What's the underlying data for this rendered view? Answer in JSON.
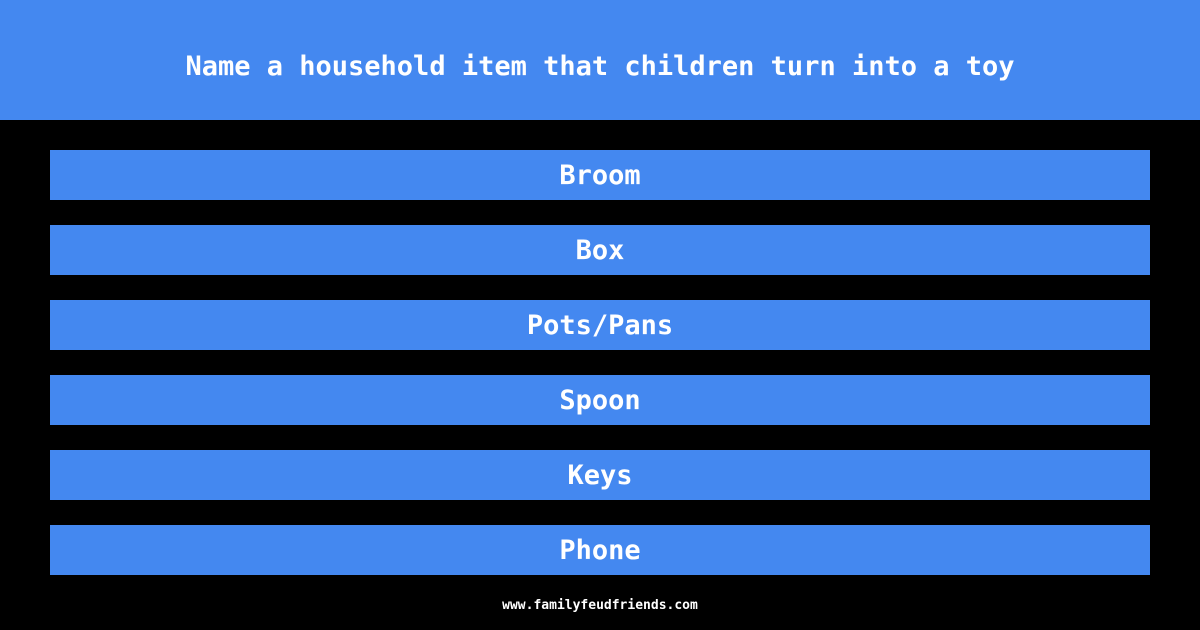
{
  "header": {
    "question": "Name a household item that children turn into a toy"
  },
  "answers": [
    {
      "label": "Broom"
    },
    {
      "label": "Box"
    },
    {
      "label": "Pots/Pans"
    },
    {
      "label": "Spoon"
    },
    {
      "label": "Keys"
    },
    {
      "label": "Phone"
    }
  ],
  "footer": {
    "site": "www.familyfeudfriends.com"
  },
  "colors": {
    "accent": "#4488f0",
    "background": "#000000",
    "text": "#ffffff"
  }
}
